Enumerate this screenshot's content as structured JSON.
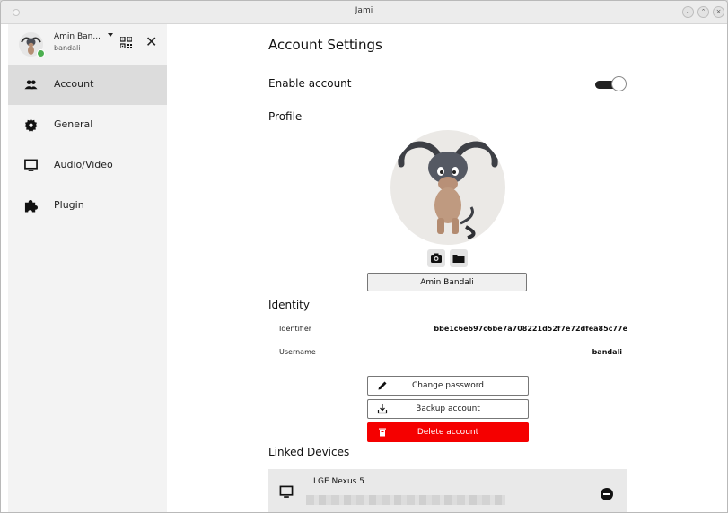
{
  "window": {
    "title": "Jami"
  },
  "account": {
    "display_name": "Amin Ban...",
    "username": "bandali"
  },
  "sidebar": {
    "items": [
      {
        "label": "Account",
        "icon": "people-icon",
        "active": true
      },
      {
        "label": "General",
        "icon": "gear-icon",
        "active": false
      },
      {
        "label": "Audio/Video",
        "icon": "monitor-icon",
        "active": false
      },
      {
        "label": "Plugin",
        "icon": "puzzle-icon",
        "active": false
      }
    ]
  },
  "settings": {
    "title": "Account Settings",
    "enable_account_label": "Enable account",
    "enable_account_on": true,
    "profile_heading": "Profile",
    "profile_name": "Amin Bandali",
    "identity_heading": "Identity",
    "identifier_label": "Identifier",
    "identifier_value": "bbe1c6e697c6be7a708221d52f7e72dfea85c77e",
    "username_label": "Username",
    "username_value": "bandali",
    "change_password_label": "Change password",
    "backup_account_label": "Backup account",
    "delete_account_label": "Delete account",
    "linked_devices_heading": "Linked Devices",
    "devices": [
      {
        "name": "LGE Nexus 5"
      }
    ]
  },
  "colors": {
    "danger": "#f50000",
    "presence": "#4caf50",
    "sidebar_bg": "#f3f3f3",
    "active_item_bg": "#dcdcdc"
  }
}
